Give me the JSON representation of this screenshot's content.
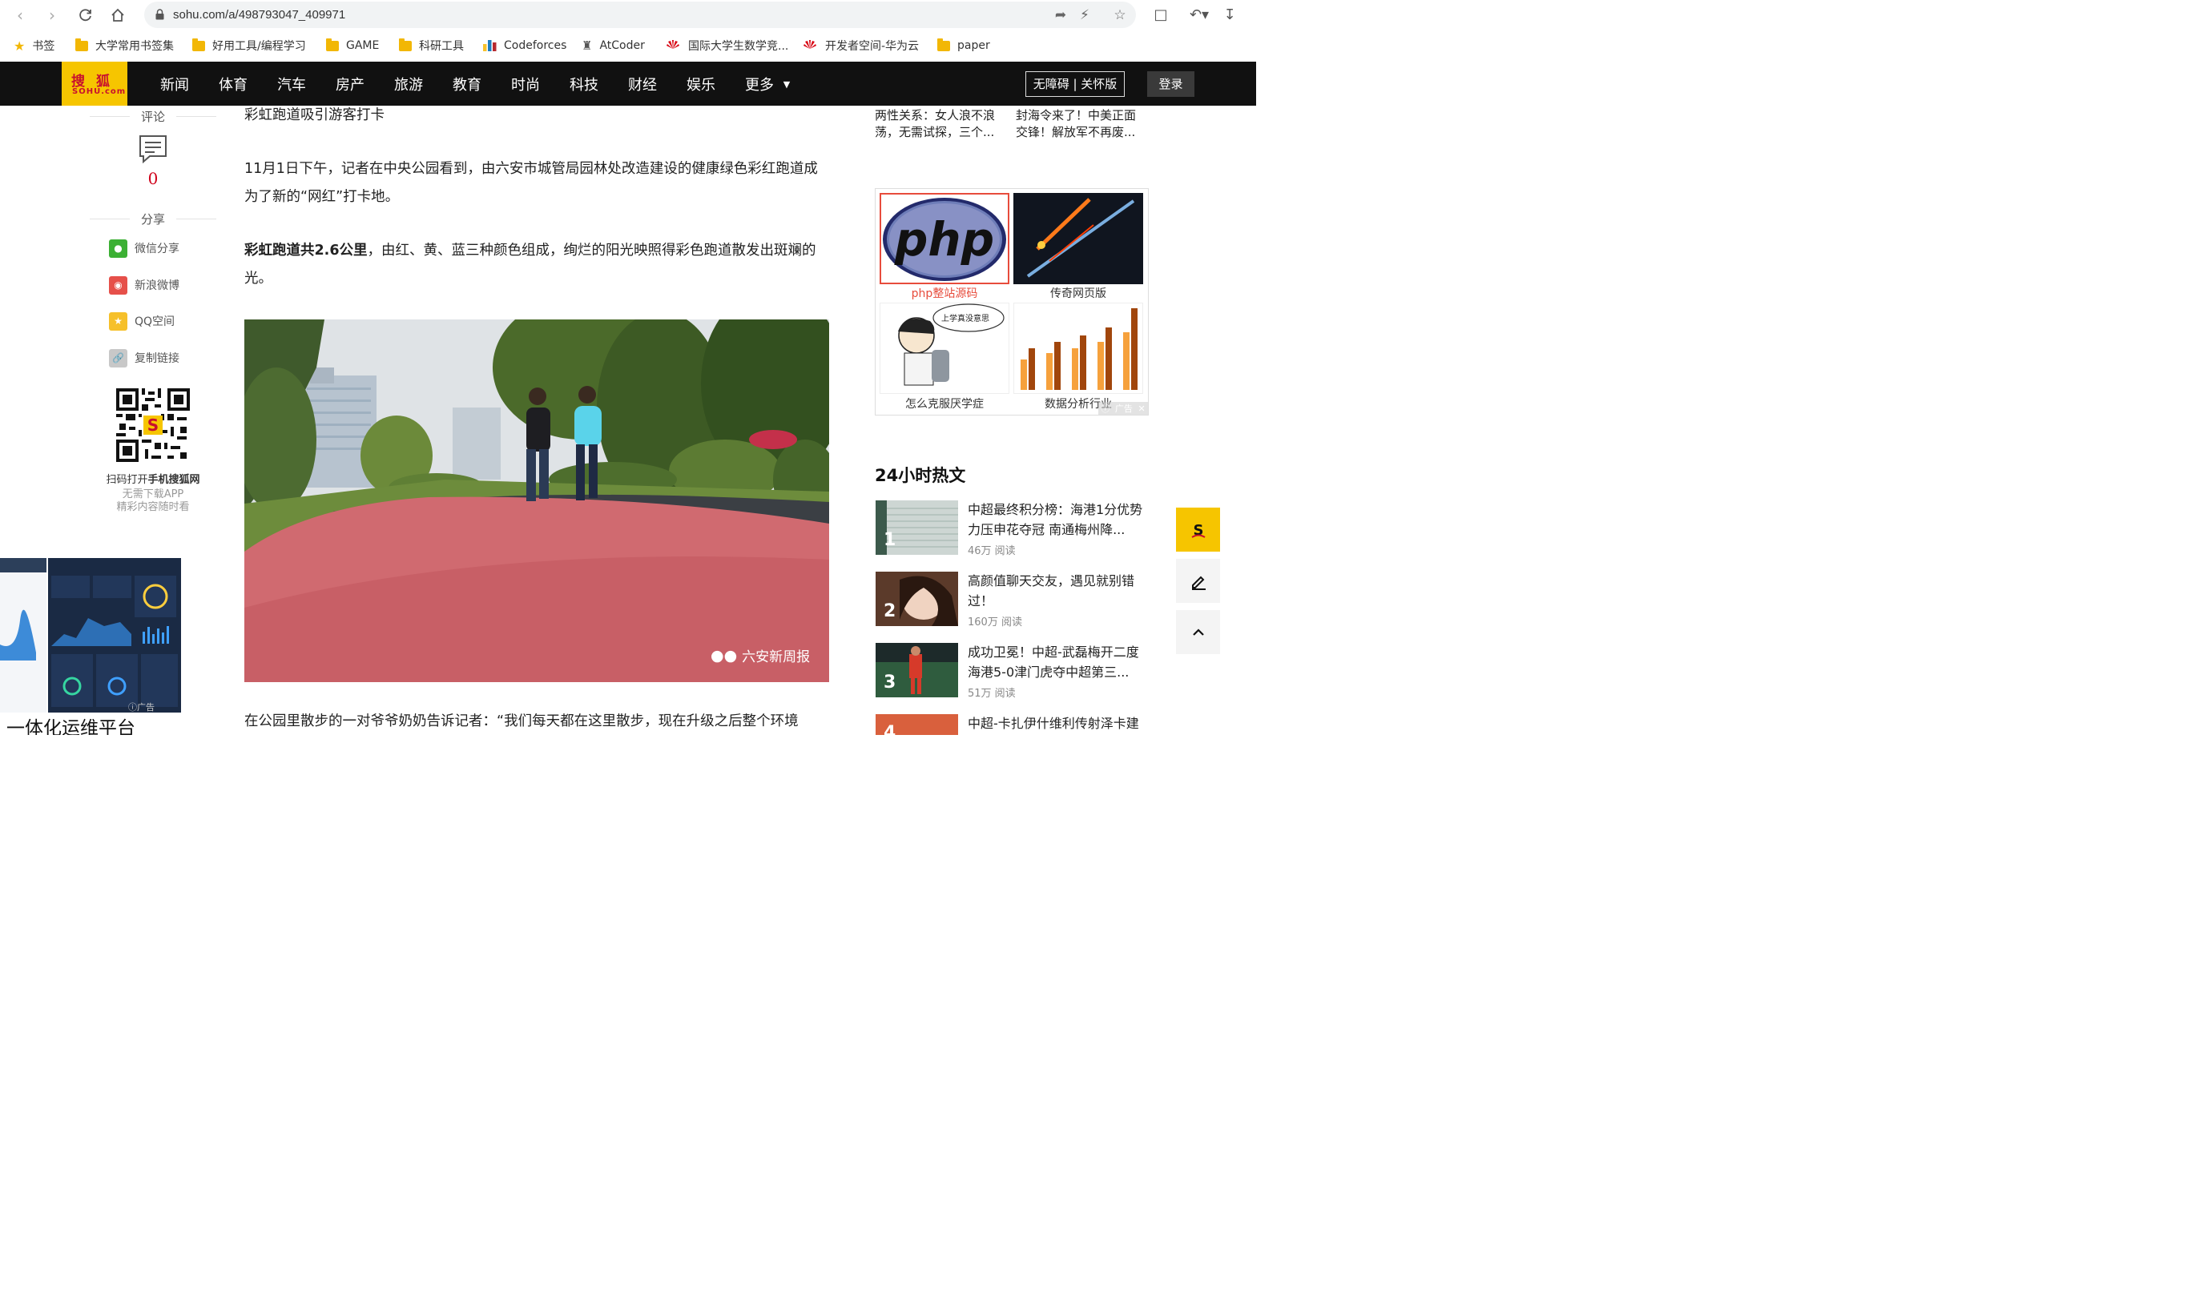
{
  "browser": {
    "url": "sohu.com/a/498793047_409971",
    "bookmarks": [
      {
        "label": "书签",
        "icon": "star-icon"
      },
      {
        "label": "大学常用书签集",
        "icon": "folder-icon"
      },
      {
        "label": "好用工具/编程学习",
        "icon": "folder-icon"
      },
      {
        "label": "GAME",
        "icon": "folder-icon"
      },
      {
        "label": "科研工具",
        "icon": "folder-icon"
      },
      {
        "label": "Codeforces",
        "icon": "codeforces-icon"
      },
      {
        "label": "AtCoder",
        "icon": "atcoder-icon"
      },
      {
        "label": "国际大学生数学竞...",
        "icon": "huawei-icon"
      },
      {
        "label": "开发者空间-华为云",
        "icon": "huawei-icon"
      },
      {
        "label": "paper",
        "icon": "folder-icon"
      }
    ]
  },
  "sohu": {
    "logo_top": "搜狐",
    "logo_bottom": "SOHU.com",
    "nav": [
      "新闻",
      "体育",
      "汽车",
      "房产",
      "旅游",
      "教育",
      "时尚",
      "科技",
      "财经",
      "娱乐",
      "更多"
    ],
    "accessibility": "无障碍 | 关怀版",
    "login": "登录"
  },
  "rail": {
    "comment_title": "评论",
    "comment_count": "0",
    "share_title": "分享",
    "shares": [
      {
        "label": "微信分享",
        "color": "#3cb034"
      },
      {
        "label": "新浪微博",
        "color": "#e6504a"
      },
      {
        "label": "QQ空间",
        "color": "#f6c02a"
      },
      {
        "label": "复制链接",
        "color": "#c8c8c8"
      }
    ],
    "qr_line1_pre": "扫码打开",
    "qr_line1_bold": "手机搜狐网",
    "qr_line2": "无需下载APP",
    "qr_line3": "精彩内容随时看"
  },
  "left_ad": {
    "title": "一体化运维平台",
    "tag": "广告"
  },
  "article": {
    "p0": "彩虹跑道吸引游客打卡",
    "p1": "11月1日下午，记者在中央公园看到，由六安市城管局园林处改造建设的健康绿色彩红跑道成为了新的“网红”打卡地。",
    "p2_bold": "彩虹跑道共2.6公里",
    "p2_rest": "，由红、黄、蓝三种颜色组成，绚烂的阳光映照得彩色跑道散发出斑斓的光。",
    "photo_watermark": "六安新周报",
    "p3": "在公园里散步的一对爷爷奶奶告诉记者：“我们每天都在这里散步，现在升级之后整个环境"
  },
  "right": {
    "top_left": "两性关系：女人浪不浪荡，无需试探，三个...",
    "top_right": "封海令来了！中美正面交锋！解放军不再废...",
    "ads": [
      {
        "caption": "php整站源码",
        "highlight": true
      },
      {
        "caption": "传奇网页版",
        "highlight": false
      },
      {
        "caption": "怎么克服厌学症",
        "highlight": false
      },
      {
        "caption": "数据分析行业",
        "highlight": false
      }
    ],
    "ad_comic_text": "上学真没意思",
    "ad_tag": "广告",
    "hot_title": "24小时热文",
    "hot": [
      {
        "rank": "1",
        "title": "中超最终积分榜：海港1分优势力压申花夺冠 南通梅州降...",
        "reads": "46万 阅读"
      },
      {
        "rank": "2",
        "title": "高颜值聊天交友，遇见就别错过！",
        "reads": "160万 阅读"
      },
      {
        "rank": "3",
        "title": "成功卫冕！中超-武磊梅开二度 海港5-0津门虎夺中超第三...",
        "reads": "51万 阅读"
      },
      {
        "rank": "4",
        "title": "中超-卡扎伊什维利传射泽卡建",
        "reads": ""
      }
    ]
  }
}
